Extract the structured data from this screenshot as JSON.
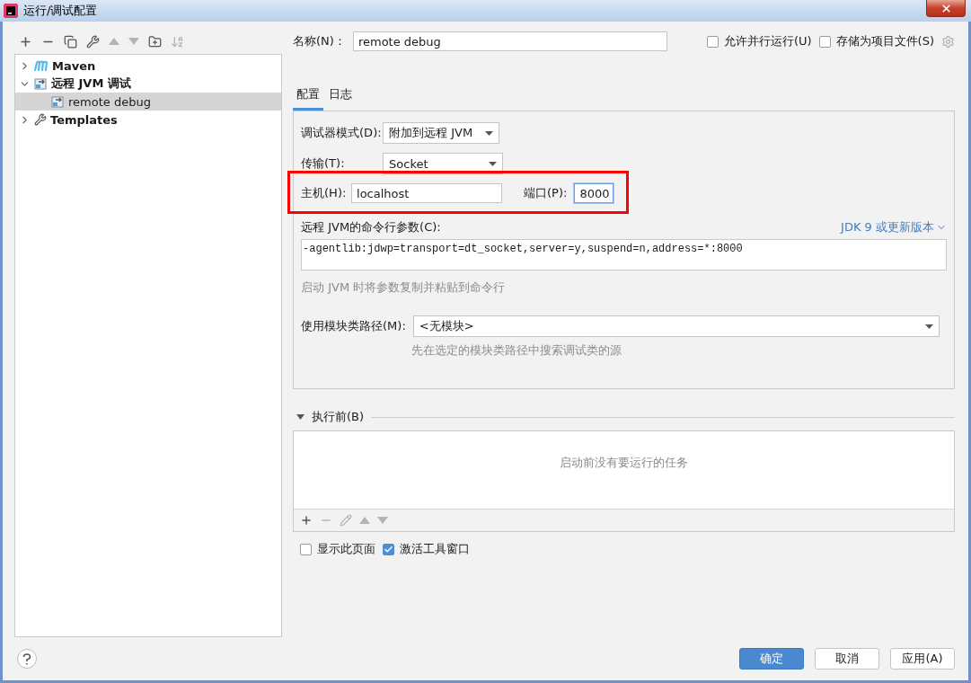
{
  "window": {
    "title": "运行/调试配置"
  },
  "toolbar": [
    {
      "kind": "add",
      "disabled": false
    },
    {
      "kind": "remove",
      "disabled": false
    },
    {
      "kind": "copy",
      "disabled": false
    },
    {
      "kind": "edit",
      "disabled": false
    },
    {
      "kind": "up",
      "disabled": true
    },
    {
      "kind": "down",
      "disabled": true
    },
    {
      "kind": "folder",
      "disabled": false
    },
    {
      "kind": "sort",
      "disabled": true
    }
  ],
  "tree": [
    {
      "label": "Maven",
      "kind": "maven",
      "expanded": false,
      "selected": false
    },
    {
      "label": "远程 JVM 调试",
      "kind": "remote",
      "expanded": true,
      "selected": false,
      "children": [
        {
          "label": "remote debug",
          "kind": "remote",
          "selected": true
        }
      ]
    },
    {
      "label": "Templates",
      "kind": "templates",
      "expanded": false,
      "selected": false
    }
  ],
  "name_field": {
    "label": "名称(N)：",
    "value": "remote debug"
  },
  "options": [
    {
      "label": "允许并行运行(U)",
      "checked": false
    },
    {
      "label": "存储为项目文件(S)",
      "checked": false
    }
  ],
  "tabs": [
    {
      "label": "配置",
      "selected": true
    },
    {
      "label": "日志",
      "selected": false
    }
  ],
  "config": {
    "debugger_mode": {
      "label": "调试器模式(D):",
      "value": "附加到远程 JVM"
    },
    "transport": {
      "label": "传输(T):",
      "value": "Socket"
    },
    "connection_highlighted": true,
    "host": {
      "label": "主机(H):",
      "value": "localhost"
    },
    "port": {
      "label": "端口(P):",
      "value": "8000",
      "focused": true
    },
    "args": {
      "label": "远程 JVM的命令行参数(C):",
      "link": "JDK 9 或更新版本",
      "value": "-agentlib:jdwp=transport=dt_socket,server=y,suspend=n,address=*:8000",
      "hint": "启动 JVM 时将参数复制并粘贴到命令行"
    },
    "module": {
      "label": "使用模块类路径(M):",
      "value": "<无模块>",
      "hint": "先在选定的模块类路径中搜索调试类的源"
    }
  },
  "before_launch": {
    "title": "执行前(B)",
    "expanded": true,
    "empty_text": "启动前没有要运行的任务",
    "toolbar": [
      {
        "kind": "add",
        "disabled": false
      },
      {
        "kind": "remove",
        "disabled": true
      },
      {
        "kind": "edit",
        "disabled": true
      },
      {
        "kind": "up",
        "disabled": true
      },
      {
        "kind": "down",
        "disabled": true
      }
    ]
  },
  "bottom_options": [
    {
      "label": "显示此页面",
      "checked": false
    },
    {
      "label": "激活工具窗口",
      "checked": true
    }
  ],
  "buttons": [
    {
      "label": "确定",
      "kind": "primary"
    },
    {
      "label": "取消",
      "kind": "default"
    },
    {
      "label": "应用(A)",
      "kind": "default"
    }
  ]
}
